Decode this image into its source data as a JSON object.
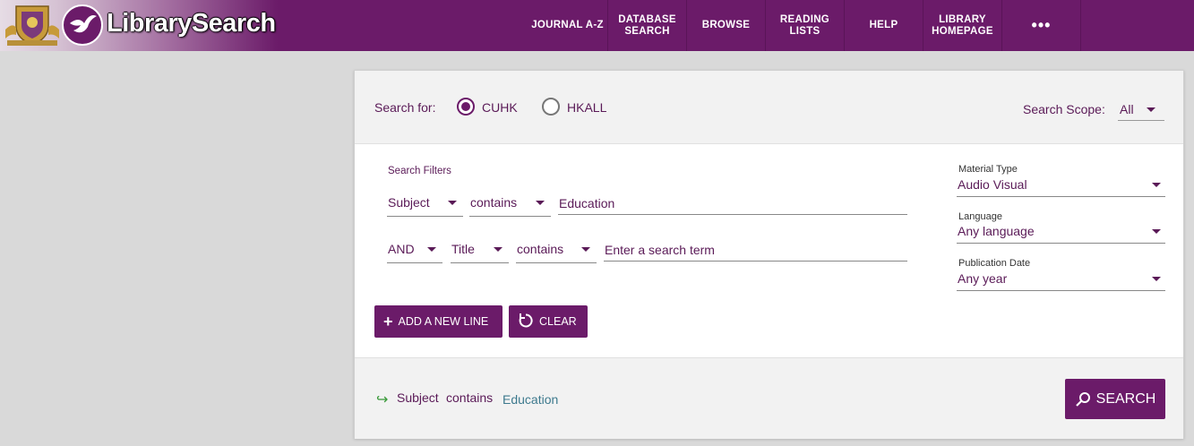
{
  "header": {
    "brand": "LibrarySearch",
    "nav": [
      {
        "label": "JOURNAL A-Z",
        "name": "nav-journal-az",
        "width": 90
      },
      {
        "label": "DATABASE\nSEARCH",
        "name": "nav-database-search",
        "width": 88
      },
      {
        "label": "BROWSE",
        "name": "nav-browse",
        "width": 88
      },
      {
        "label": "READING\nLISTS",
        "name": "nav-reading-lists",
        "width": 88
      },
      {
        "label": "HELP",
        "name": "nav-help",
        "width": 88
      },
      {
        "label": "LIBRARY\nHOMEPAGE",
        "name": "nav-library-homepage",
        "width": 88
      },
      {
        "label": "•••",
        "name": "nav-more",
        "width": 88
      }
    ]
  },
  "search_for": {
    "label": "Search for:",
    "options": [
      "CUHK",
      "HKALL"
    ],
    "selected": "CUHK"
  },
  "scope": {
    "label": "Search Scope:",
    "value": "All"
  },
  "filters": {
    "title": "Search Filters",
    "line1": {
      "field": "Subject",
      "operator": "contains",
      "term": "Education"
    },
    "line2": {
      "boolean": "AND",
      "field": "Title",
      "operator": "contains",
      "placeholder": "Enter a search term"
    }
  },
  "side": {
    "material": {
      "label": "Material Type",
      "value": "Audio Visual"
    },
    "language": {
      "label": "Language",
      "value": "Any language"
    },
    "date": {
      "label": "Publication Date",
      "value": "Any year"
    }
  },
  "buttons": {
    "add_line": "ADD A NEW LINE",
    "clear": "CLEAR",
    "search": "SEARCH"
  },
  "query_summary": {
    "field": "Subject",
    "operator": "contains",
    "term": "Education"
  },
  "colors": {
    "brand": "#6b1b69",
    "text": "#5a1a57",
    "term": "#3e7a8e",
    "arrow": "#3a9a3a"
  }
}
